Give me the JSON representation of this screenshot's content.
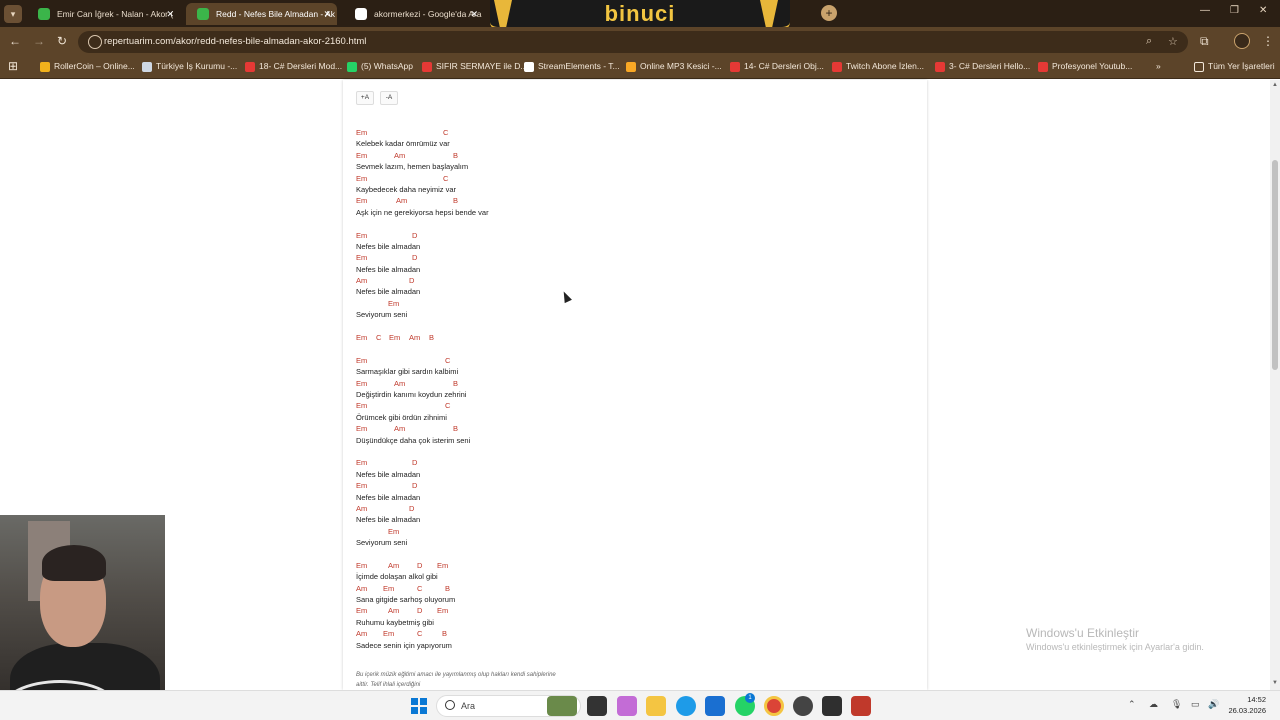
{
  "tabs": [
    {
      "title": "Emir Can İğrek - Nalan - Akor (",
      "active": false,
      "favicon_color": "#3bb54a"
    },
    {
      "title": "Redd - Nefes Bile Almadan - Ak",
      "active": true,
      "favicon_color": "#3bb54a"
    },
    {
      "title": "akormerkezi - Google'da Ara",
      "active": false,
      "favicon_color": "#ffffff"
    }
  ],
  "overlay": {
    "banner_text": "binuci"
  },
  "address": {
    "url": "repertuarim.com/akor/redd-nefes-bile-almadan-akor-2160.html"
  },
  "bookmarks": [
    {
      "label": "RollerCoin – Online...",
      "color": "#f2b21c"
    },
    {
      "label": "Türkiye İş Kurumu -...",
      "color": "#cfd8e3"
    },
    {
      "label": "18- C# Dersleri Mod...",
      "color": "#e53935"
    },
    {
      "label": "(5) WhatsApp",
      "color": "#25d366"
    },
    {
      "label": "SIFIR SERMAYE ile D...",
      "color": "#e53935"
    },
    {
      "label": "StreamElements - T...",
      "color": "#ffffff"
    },
    {
      "label": "Online MP3 Kesici -...",
      "color": "#f9a825"
    },
    {
      "label": "14- C# Dersleri Obj...",
      "color": "#e53935"
    },
    {
      "label": "Twitch Abone İzlen...",
      "color": "#e53935"
    },
    {
      "label": "3- C# Dersleri Hello...",
      "color": "#e53935"
    },
    {
      "label": "Profesyonel Youtub...",
      "color": "#e53935"
    }
  ],
  "bookmarks_overflow": "»",
  "all_bookmarks": "Tüm Yer İşaretleri",
  "font_controls": {
    "increase": "+A",
    "decrease": "-A"
  },
  "lyrics": [
    {
      "type": "chord",
      "chords": [
        {
          "c": "Em",
          "at": 0
        },
        {
          "c": "C",
          "at": 87
        }
      ]
    },
    {
      "type": "text",
      "value": "Kelebek kadar ömrümüz var"
    },
    {
      "type": "chord",
      "chords": [
        {
          "c": "Em",
          "at": 0
        },
        {
          "c": "Am",
          "at": 38
        },
        {
          "c": "B",
          "at": 97
        }
      ]
    },
    {
      "type": "text",
      "value": "Sevmek lazım, hemen başlayalım"
    },
    {
      "type": "chord",
      "chords": [
        {
          "c": "Em",
          "at": 0
        },
        {
          "c": "C",
          "at": 87
        }
      ]
    },
    {
      "type": "text",
      "value": "Kaybedecek daha neyimiz var"
    },
    {
      "type": "chord",
      "chords": [
        {
          "c": "Em",
          "at": 0
        },
        {
          "c": "Am",
          "at": 40
        },
        {
          "c": "B",
          "at": 97
        }
      ]
    },
    {
      "type": "text",
      "value": "Aşk için ne gerekiyorsa hepsi bende var"
    },
    {
      "type": "gap"
    },
    {
      "type": "chord",
      "chords": [
        {
          "c": "Em",
          "at": 0
        },
        {
          "c": "D",
          "at": 56
        }
      ]
    },
    {
      "type": "text",
      "value": "Nefes bile almadan"
    },
    {
      "type": "chord",
      "chords": [
        {
          "c": "Em",
          "at": 0
        },
        {
          "c": "D",
          "at": 56
        }
      ]
    },
    {
      "type": "text",
      "value": "Nefes bile almadan"
    },
    {
      "type": "chord",
      "chords": [
        {
          "c": "Am",
          "at": 0
        },
        {
          "c": "D",
          "at": 53
        }
      ]
    },
    {
      "type": "text",
      "value": "Nefes bile almadan"
    },
    {
      "type": "chord",
      "chords": [
        {
          "c": "Em",
          "at": 32
        }
      ]
    },
    {
      "type": "text",
      "value": "Seviyorum seni"
    },
    {
      "type": "gap"
    },
    {
      "type": "chord",
      "chords": [
        {
          "c": "Em",
          "at": 0
        },
        {
          "c": "C",
          "at": 20
        },
        {
          "c": "Em",
          "at": 33
        },
        {
          "c": "Am",
          "at": 53
        },
        {
          "c": "B",
          "at": 73
        }
      ]
    },
    {
      "type": "gap"
    },
    {
      "type": "chord",
      "chords": [
        {
          "c": "Em",
          "at": 0
        },
        {
          "c": "C",
          "at": 89
        }
      ]
    },
    {
      "type": "text",
      "value": "Sarmaşıklar gibi sardın kalbimi"
    },
    {
      "type": "chord",
      "chords": [
        {
          "c": "Em",
          "at": 0
        },
        {
          "c": "Am",
          "at": 38
        },
        {
          "c": "B",
          "at": 97
        }
      ]
    },
    {
      "type": "text",
      "value": "Değiştirdin kanımı koydun zehrini"
    },
    {
      "type": "chord",
      "chords": [
        {
          "c": "Em",
          "at": 0
        },
        {
          "c": "C",
          "at": 89
        }
      ]
    },
    {
      "type": "text",
      "value": "Örümcek gibi ördün zihnimi"
    },
    {
      "type": "chord",
      "chords": [
        {
          "c": "Em",
          "at": 0
        },
        {
          "c": "Am",
          "at": 38
        },
        {
          "c": "B",
          "at": 97
        }
      ]
    },
    {
      "type": "text",
      "value": "Düşündükçe daha çok isterim seni"
    },
    {
      "type": "gap"
    },
    {
      "type": "chord",
      "chords": [
        {
          "c": "Em",
          "at": 0
        },
        {
          "c": "D",
          "at": 56
        }
      ]
    },
    {
      "type": "text",
      "value": "Nefes bile almadan"
    },
    {
      "type": "chord",
      "chords": [
        {
          "c": "Em",
          "at": 0
        },
        {
          "c": "D",
          "at": 56
        }
      ]
    },
    {
      "type": "text",
      "value": "Nefes bile almadan"
    },
    {
      "type": "chord",
      "chords": [
        {
          "c": "Am",
          "at": 0
        },
        {
          "c": "D",
          "at": 53
        }
      ]
    },
    {
      "type": "text",
      "value": "Nefes bile almadan"
    },
    {
      "type": "chord",
      "chords": [
        {
          "c": "Em",
          "at": 32
        }
      ]
    },
    {
      "type": "text",
      "value": "Seviyorum seni"
    },
    {
      "type": "gap"
    },
    {
      "type": "chord",
      "chords": [
        {
          "c": "Em",
          "at": 0
        },
        {
          "c": "Am",
          "at": 32
        },
        {
          "c": "D",
          "at": 61
        },
        {
          "c": "Em",
          "at": 81
        }
      ]
    },
    {
      "type": "text",
      "value": "İçimde dolaşan alkol gibi"
    },
    {
      "type": "chord",
      "chords": [
        {
          "c": "Am",
          "at": 0
        },
        {
          "c": "Em",
          "at": 27
        },
        {
          "c": "C",
          "at": 61
        },
        {
          "c": "B",
          "at": 89
        }
      ]
    },
    {
      "type": "text",
      "value": "Sana gitgide sarhoş oluyorum"
    },
    {
      "type": "chord",
      "chords": [
        {
          "c": "Em",
          "at": 0
        },
        {
          "c": "Am",
          "at": 32
        },
        {
          "c": "D",
          "at": 61
        },
        {
          "c": "Em",
          "at": 81
        }
      ]
    },
    {
      "type": "text",
      "value": "Ruhumu kaybetmiş gibi"
    },
    {
      "type": "chord",
      "chords": [
        {
          "c": "Am",
          "at": 0
        },
        {
          "c": "Em",
          "at": 27
        },
        {
          "c": "C",
          "at": 61
        },
        {
          "c": "B",
          "at": 86
        }
      ]
    },
    {
      "type": "text",
      "value": "Sadece senin için yapıyorum"
    }
  ],
  "footnote": "Bu içerik müzik eğitimi amacı ile yayımlanmış olup hakları kendi sahiplerine aittir. Telif ihlali içerdiğini",
  "watermark": {
    "title": "Windows'u Etkinleştir",
    "subtitle": "Windows'u etkinleştirmek için Ayarlar'a gidin."
  },
  "taskbar": {
    "search_placeholder": "Ara",
    "whatsapp_badge": "1",
    "time": "14:52",
    "date": "26.03.2026"
  }
}
